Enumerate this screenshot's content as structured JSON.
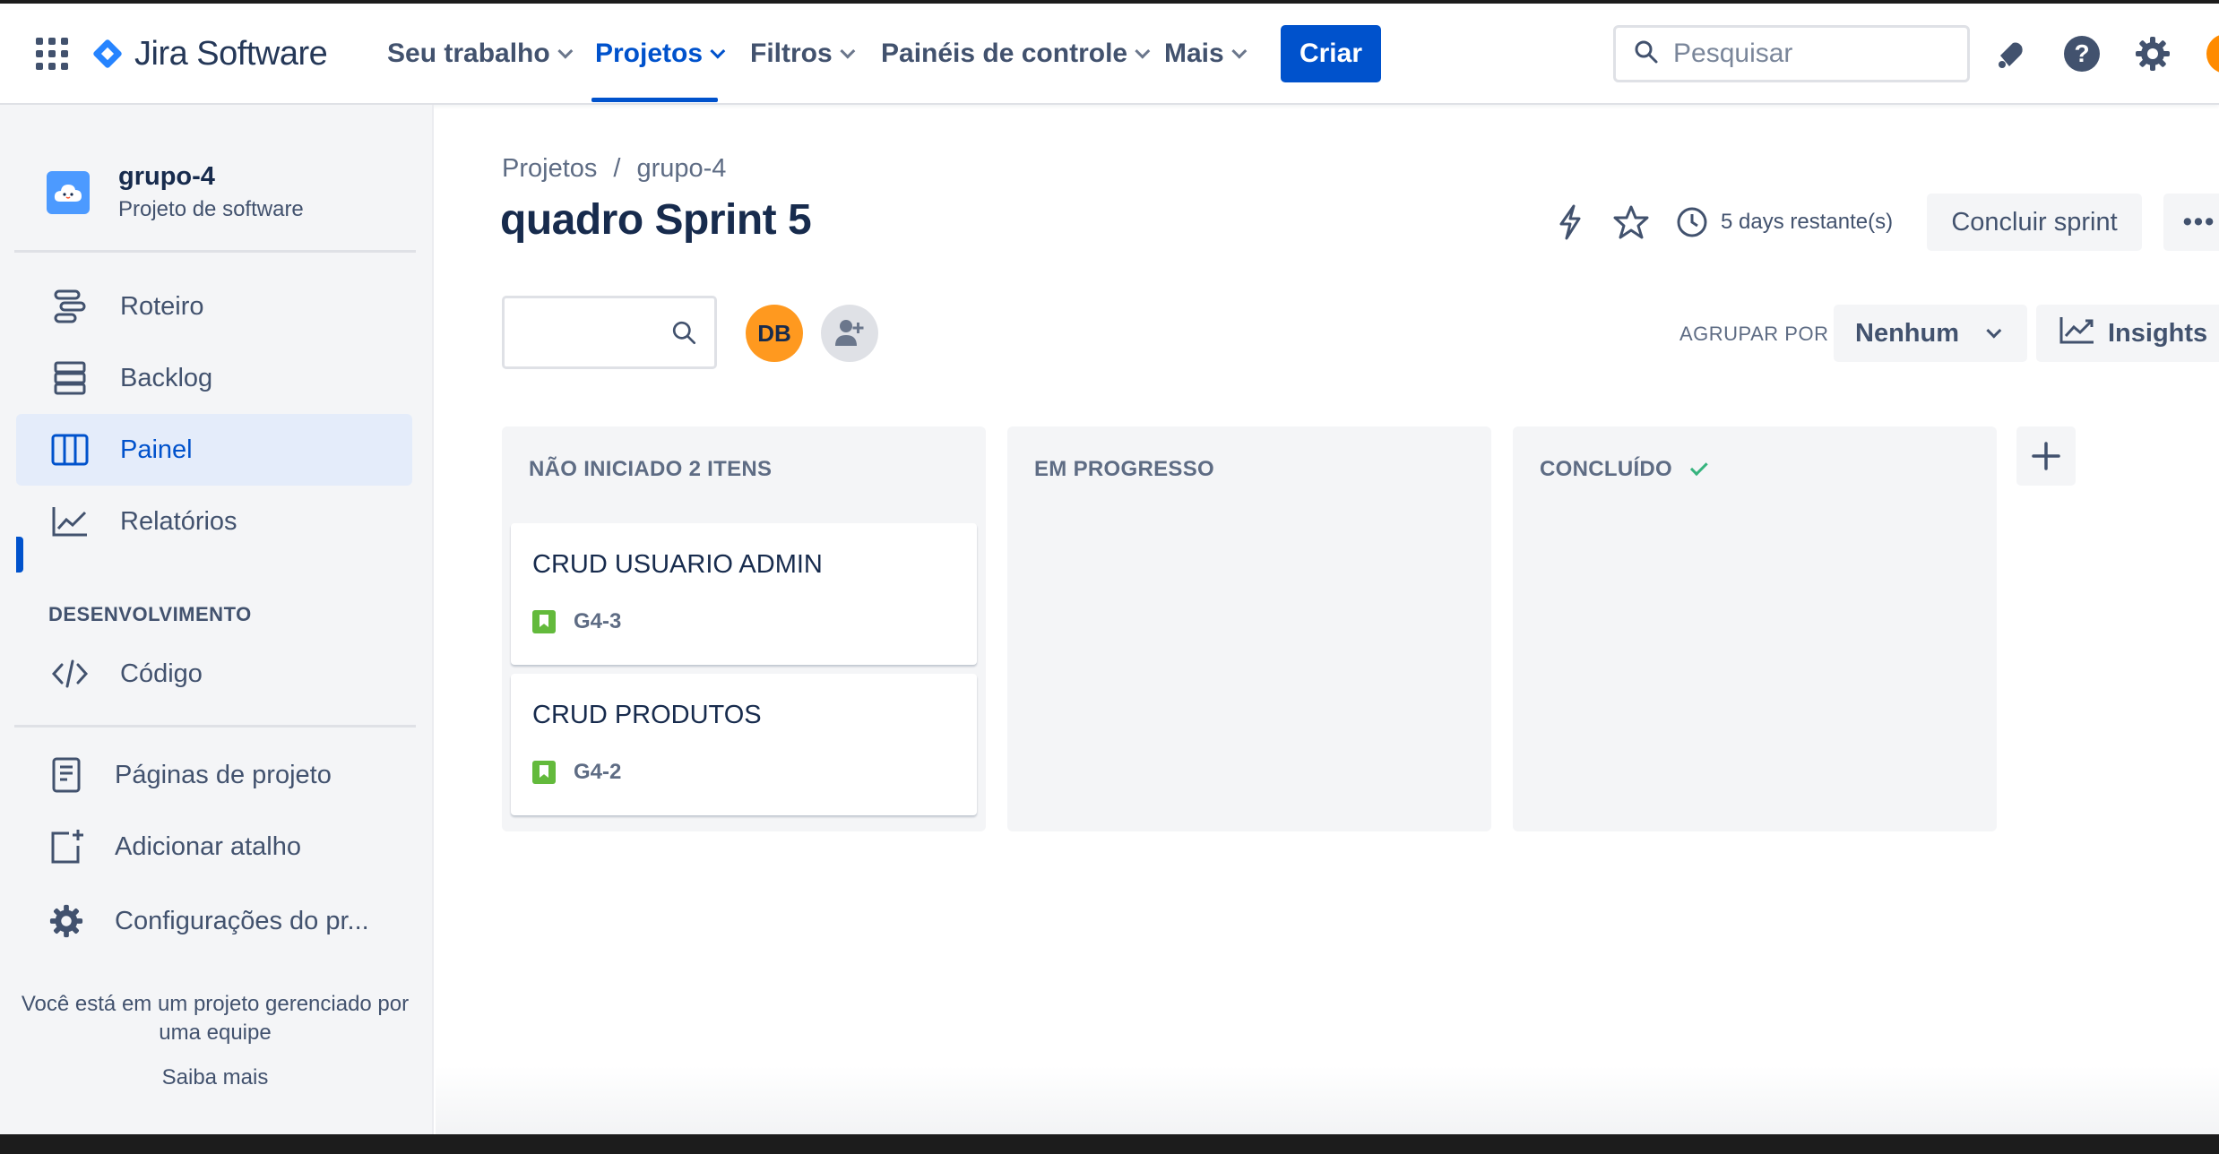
{
  "app": {
    "title": "Jira Software"
  },
  "topnav": {
    "items": [
      {
        "label": "Seu trabalho",
        "active": false
      },
      {
        "label": "Projetos",
        "active": true
      },
      {
        "label": "Filtros",
        "active": false
      },
      {
        "label": "Painéis de controle",
        "active": false
      },
      {
        "label": "Mais",
        "active": false
      }
    ],
    "create_label": "Criar",
    "search_placeholder": "Pesquisar",
    "icons": [
      "apps-grid-icon",
      "notifications-icon",
      "help-icon",
      "settings-icon",
      "user-avatar"
    ]
  },
  "sidebar": {
    "project_name": "grupo-4",
    "project_type": "Projeto de software",
    "items": [
      {
        "label": "Roteiro",
        "icon": "roadmap-icon"
      },
      {
        "label": "Backlog",
        "icon": "backlog-icon"
      },
      {
        "label": "Painel",
        "icon": "board-icon",
        "active": true
      },
      {
        "label": "Relatórios",
        "icon": "reports-icon"
      }
    ],
    "section_heading": "DESENVOLVIMENTO",
    "dev_items": [
      {
        "label": "Código",
        "icon": "code-icon"
      }
    ],
    "bottom_items": [
      {
        "label": "Páginas de projeto",
        "icon": "pages-icon"
      },
      {
        "label": "Adicionar atalho",
        "icon": "add-shortcut-icon"
      },
      {
        "label": "Configurações do pr...",
        "icon": "settings-icon"
      }
    ],
    "footer_text": "Você está em um projeto gerenciado por uma equipe",
    "footer_link": "Saiba mais"
  },
  "main": {
    "breadcrumb": [
      "Projetos",
      "grupo-4"
    ],
    "breadcrumb_sep": "/",
    "title": "quadro Sprint 5",
    "days_remaining": "5 days restante(s)",
    "complete_sprint_label": "Concluir sprint",
    "more_label": "•••",
    "avatar_initials": "DB",
    "group_by_label": "AGRUPAR POR",
    "group_by_value": "Nenhum",
    "insights_label": "Insights",
    "accent_color": "#0052cc"
  },
  "board": {
    "columns": [
      {
        "title": "NÃO INICIADO 2 ITENS",
        "cards": [
          {
            "title": "CRUD USUARIO ADMIN",
            "key": "G4-3",
            "type": "story"
          },
          {
            "title": "CRUD PRODUTOS",
            "key": "G4-2",
            "type": "story"
          }
        ]
      },
      {
        "title": "EM PROGRESSO",
        "cards": []
      },
      {
        "title": "CONCLUÍDO",
        "cards": [],
        "done": true
      }
    ]
  }
}
